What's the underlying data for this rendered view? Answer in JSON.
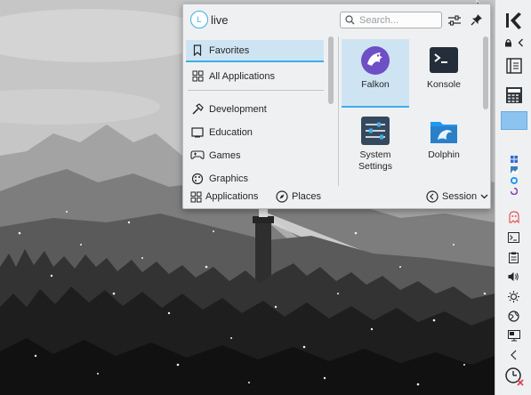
{
  "launcher": {
    "user_initial": "L",
    "user_name": "live",
    "search_placeholder": "Search...",
    "categories": [
      {
        "label": "Favorites",
        "icon": "bookmark-icon",
        "selected": true
      },
      {
        "label": "All Applications",
        "icon": "grid-icon",
        "selected": false
      },
      {
        "label": "Development",
        "icon": "hammer-icon",
        "selected": false
      },
      {
        "label": "Education",
        "icon": "screen-icon",
        "selected": false
      },
      {
        "label": "Games",
        "icon": "gamepad-icon",
        "selected": false
      },
      {
        "label": "Graphics",
        "icon": "palette-icon",
        "selected": false
      }
    ],
    "apps": [
      {
        "label": "Falkon",
        "icon": "falkon-icon",
        "selected": true
      },
      {
        "label": "Konsole",
        "icon": "konsole-icon",
        "selected": false
      },
      {
        "label": "System Settings",
        "icon": "system-settings-icon",
        "selected": false
      },
      {
        "label": "Dolphin",
        "icon": "dolphin-icon",
        "selected": false
      }
    ],
    "footer": {
      "applications": "Applications",
      "places": "Places",
      "session": "Session"
    }
  },
  "colors": {
    "accent": "#3daee9",
    "selection": "#cfe4f3",
    "panel": "#eff0f1"
  }
}
